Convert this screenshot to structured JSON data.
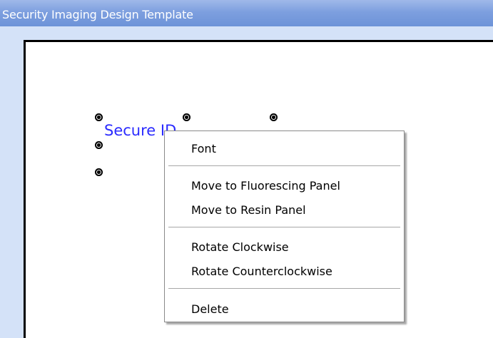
{
  "window": {
    "title": "Security Imaging Design Template"
  },
  "canvas": {
    "text_object": "Secure ID"
  },
  "context_menu": {
    "items": [
      {
        "label": "Font"
      },
      {
        "label": "Move to Fluorescing Panel"
      },
      {
        "label": "Move to Resin Panel"
      },
      {
        "label": "Rotate Clockwise"
      },
      {
        "label": "Rotate Counterclockwise"
      },
      {
        "label": "Delete"
      }
    ]
  },
  "colors": {
    "title_bar": "#7d9fdf",
    "frame": "#d4e2f8",
    "text_object": "#2b2bff",
    "menu_background": "#ffffff"
  }
}
